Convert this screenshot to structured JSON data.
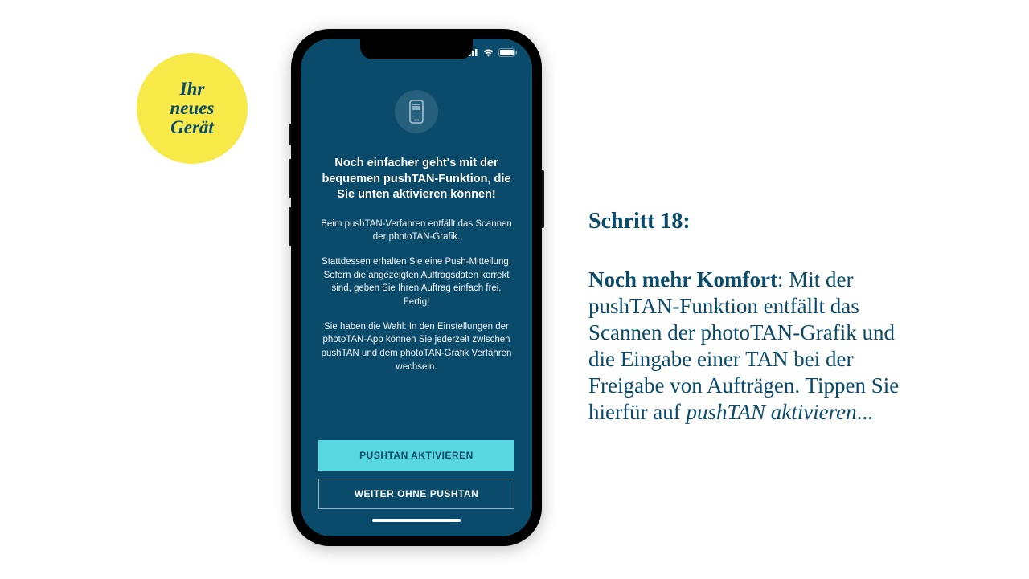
{
  "badge": {
    "line1": "Ihr",
    "line2": "neues",
    "line3": "Gerät"
  },
  "phone": {
    "heading": "Noch einfacher geht's mit der bequemen pushTAN-Funktion, die Sie unten aktivieren können!",
    "para1": "Beim pushTAN-Verfahren entfällt das Scannen der photoTAN-Grafik.",
    "para2": "Stattdessen erhalten Sie eine Push-Mitteilung. Sofern die angezeigten Auftragsdaten korrekt sind, geben Sie Ihren Auftrag einfach frei. Fertig!",
    "para3": "Sie haben die Wahl: In den Einstellungen der photoTAN-App können Sie jederzeit zwischen pushTAN und dem photoTAN-Grafik Verfahren wechseln.",
    "primary_btn": "PUSHTAN AKTIVIEREN",
    "secondary_btn": "WEITER OHNE PUSHTAN"
  },
  "instructions": {
    "step_label": "Schritt 18:",
    "bold_lead": "Noch mehr Komfort",
    "body_middle": ": Mit der pushTAN-Funktion entfällt das Scannen der photoTAN-Grafik und die Eingabe einer TAN bei der Freigabe von Aufträgen. Tippen Sie hierfür auf ",
    "italic_action": "pushTAN aktivieren",
    "trailing": "..."
  }
}
